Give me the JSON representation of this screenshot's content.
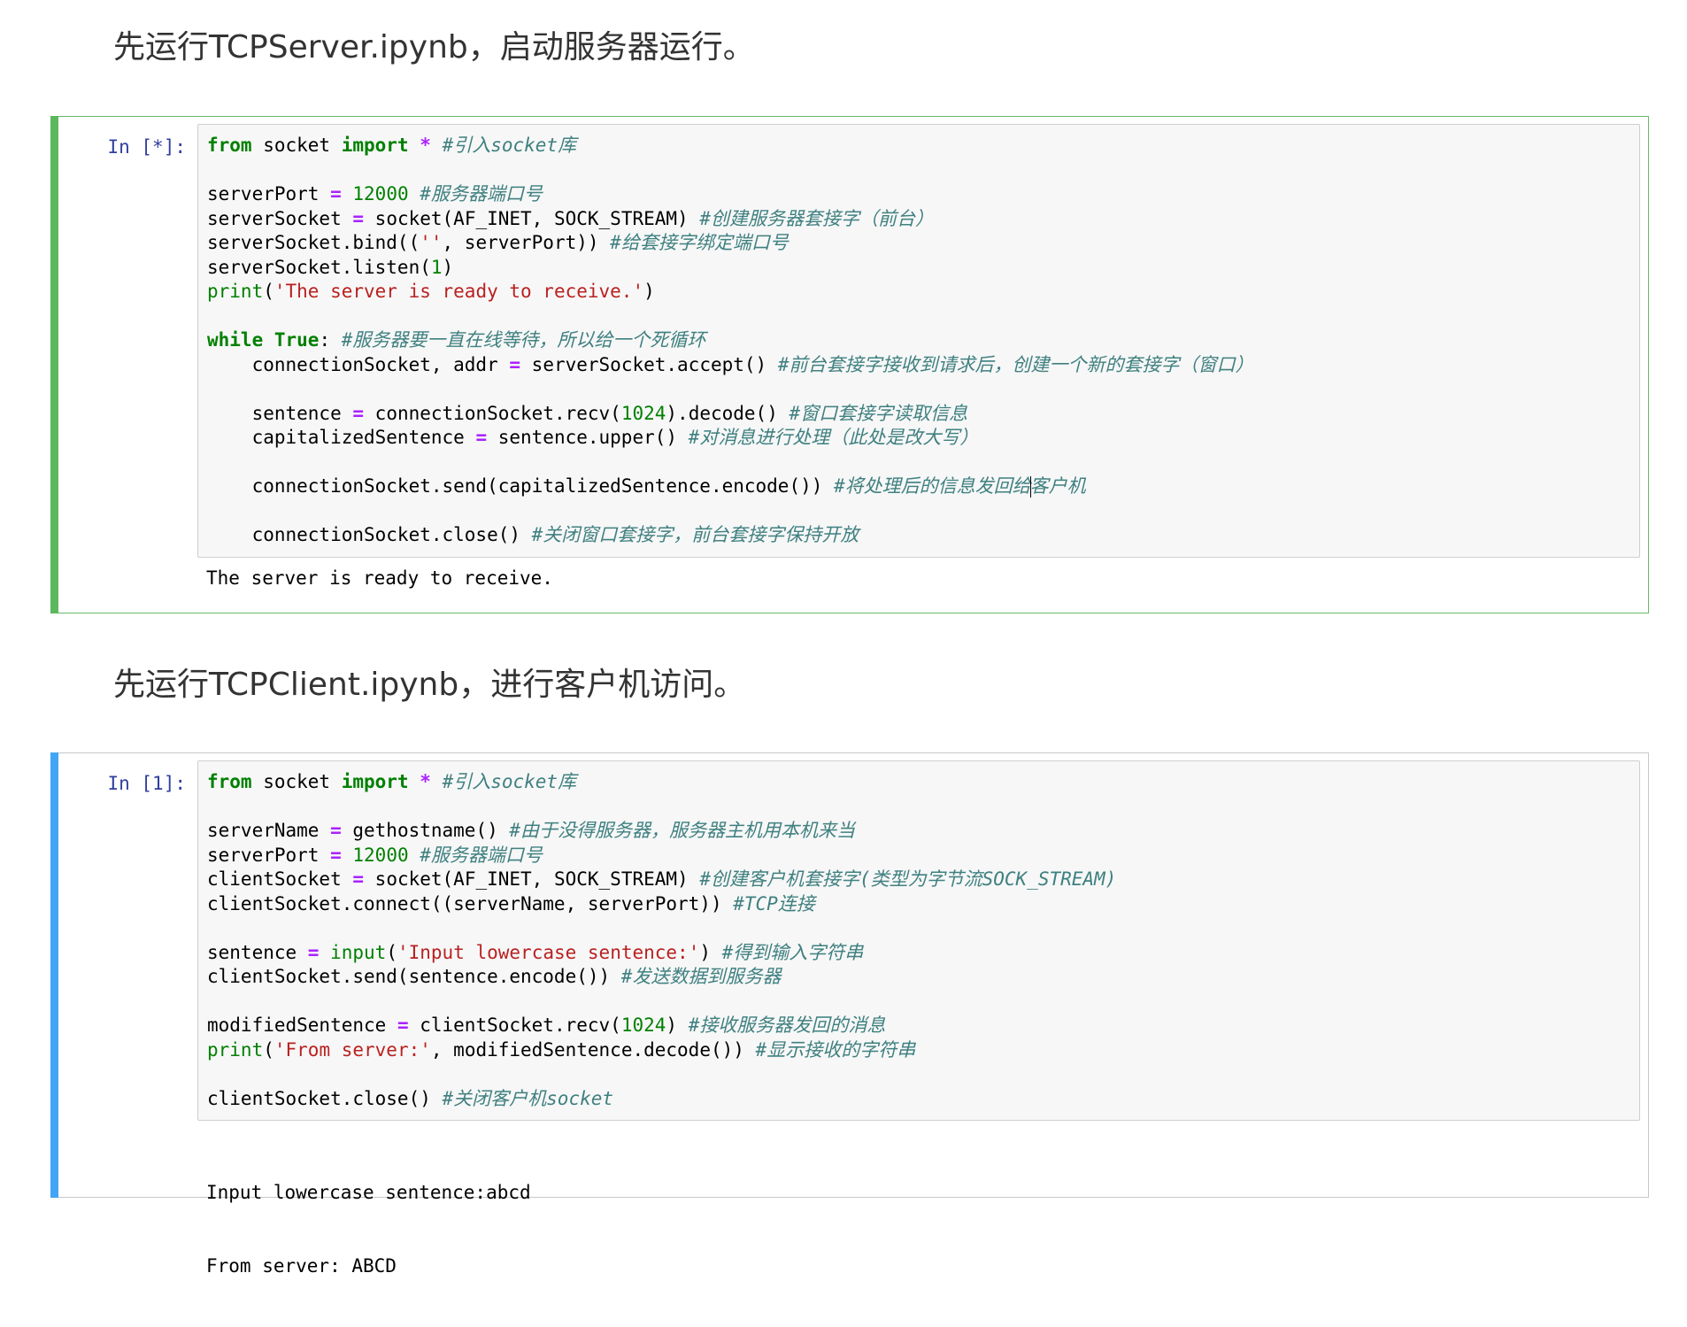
{
  "colors": {
    "edit_bar": "#5cb85c",
    "select_bar": "#42a5f5",
    "prompt": "#303f9f",
    "keyword": "#008000",
    "string": "#ba2121",
    "comment": "#408080",
    "operator": "#aa22ff"
  },
  "heading1": "先运行TCPServer.ipynb，启动服务器运行。",
  "heading2": "先运行TCPClient.ipynb，进行客户机访问。",
  "server_cell": {
    "prompt": "In [*]:",
    "output": "The server is ready to receive."
  },
  "client_cell": {
    "prompt": "In [1]:",
    "output_lines": [
      "Input lowercase sentence:abcd",
      "From server: ABCD"
    ]
  },
  "server_code": {
    "l1": [
      "from",
      " socket ",
      "import",
      " ",
      "*",
      " ",
      "#引入socket库"
    ],
    "l3": [
      "serverPort ",
      "=",
      " ",
      "12000",
      " ",
      "#服务器端口号"
    ],
    "l4": [
      "serverSocket ",
      "=",
      " socket(AF_INET, SOCK_STREAM) ",
      "#创建服务器套接字（前台）"
    ],
    "l5": [
      "serverSocket.bind((",
      "''",
      ", serverPort)) ",
      "#给套接字绑定端口号"
    ],
    "l6": [
      "serverSocket.listen(",
      "1",
      ")"
    ],
    "l7": [
      "print",
      "(",
      "'The server is ready to receive.'",
      ")"
    ],
    "l9": [
      "while",
      " ",
      "True",
      ": ",
      "#服务器要一直在线等待，所以给一个死循环"
    ],
    "l10": [
      "    connectionSocket, addr ",
      "=",
      " serverSocket.accept() ",
      "#前台套接字接收到请求后，创建一个新的套接字（窗口）"
    ],
    "l12": [
      "    sentence ",
      "=",
      " connectionSocket.recv(",
      "1024",
      ").decode() ",
      "#窗口套接字读取信息"
    ],
    "l13": [
      "    capitalizedSentence ",
      "=",
      " sentence.upper() ",
      "#对消息进行处理（此处是改大写）"
    ],
    "l15": [
      "    connectionSocket.send(capitalizedSentence.encode()) ",
      "#将处理后的信息发回给",
      "客户机"
    ],
    "l17": [
      "    connectionSocket.close() ",
      "#关闭窗口套接字，前台套接字保持开放"
    ]
  },
  "client_code": {
    "l1": [
      "from",
      " socket ",
      "import",
      " ",
      "*",
      " ",
      "#引入socket库"
    ],
    "l3": [
      "serverName ",
      "=",
      " gethostname() ",
      "#由于没得服务器，服务器主机用本机来当"
    ],
    "l4": [
      "serverPort ",
      "=",
      " ",
      "12000",
      " ",
      "#服务器端口号"
    ],
    "l5": [
      "clientSocket ",
      "=",
      " socket(AF_INET, SOCK_STREAM) ",
      "#创建客户机套接字(类型为字节流SOCK_STREAM)"
    ],
    "l6": [
      "clientSocket.connect((serverName, serverPort)) ",
      "#TCP连接"
    ],
    "l8": [
      "sentence ",
      "=",
      " ",
      "input",
      "(",
      "'Input lowercase sentence:'",
      ") ",
      "#得到输入字符串"
    ],
    "l9": [
      "clientSocket.send(sentence.encode()) ",
      "#发送数据到服务器"
    ],
    "l11": [
      "modifiedSentence ",
      "=",
      " clientSocket.recv(",
      "1024",
      ") ",
      "#接收服务器发回的消息"
    ],
    "l12": [
      "print",
      "(",
      "'From server:'",
      ", modifiedSentence.decode()) ",
      "#显示接收的字符串"
    ],
    "l14": [
      "clientSocket.close() ",
      "#关闭客户机socket"
    ]
  }
}
